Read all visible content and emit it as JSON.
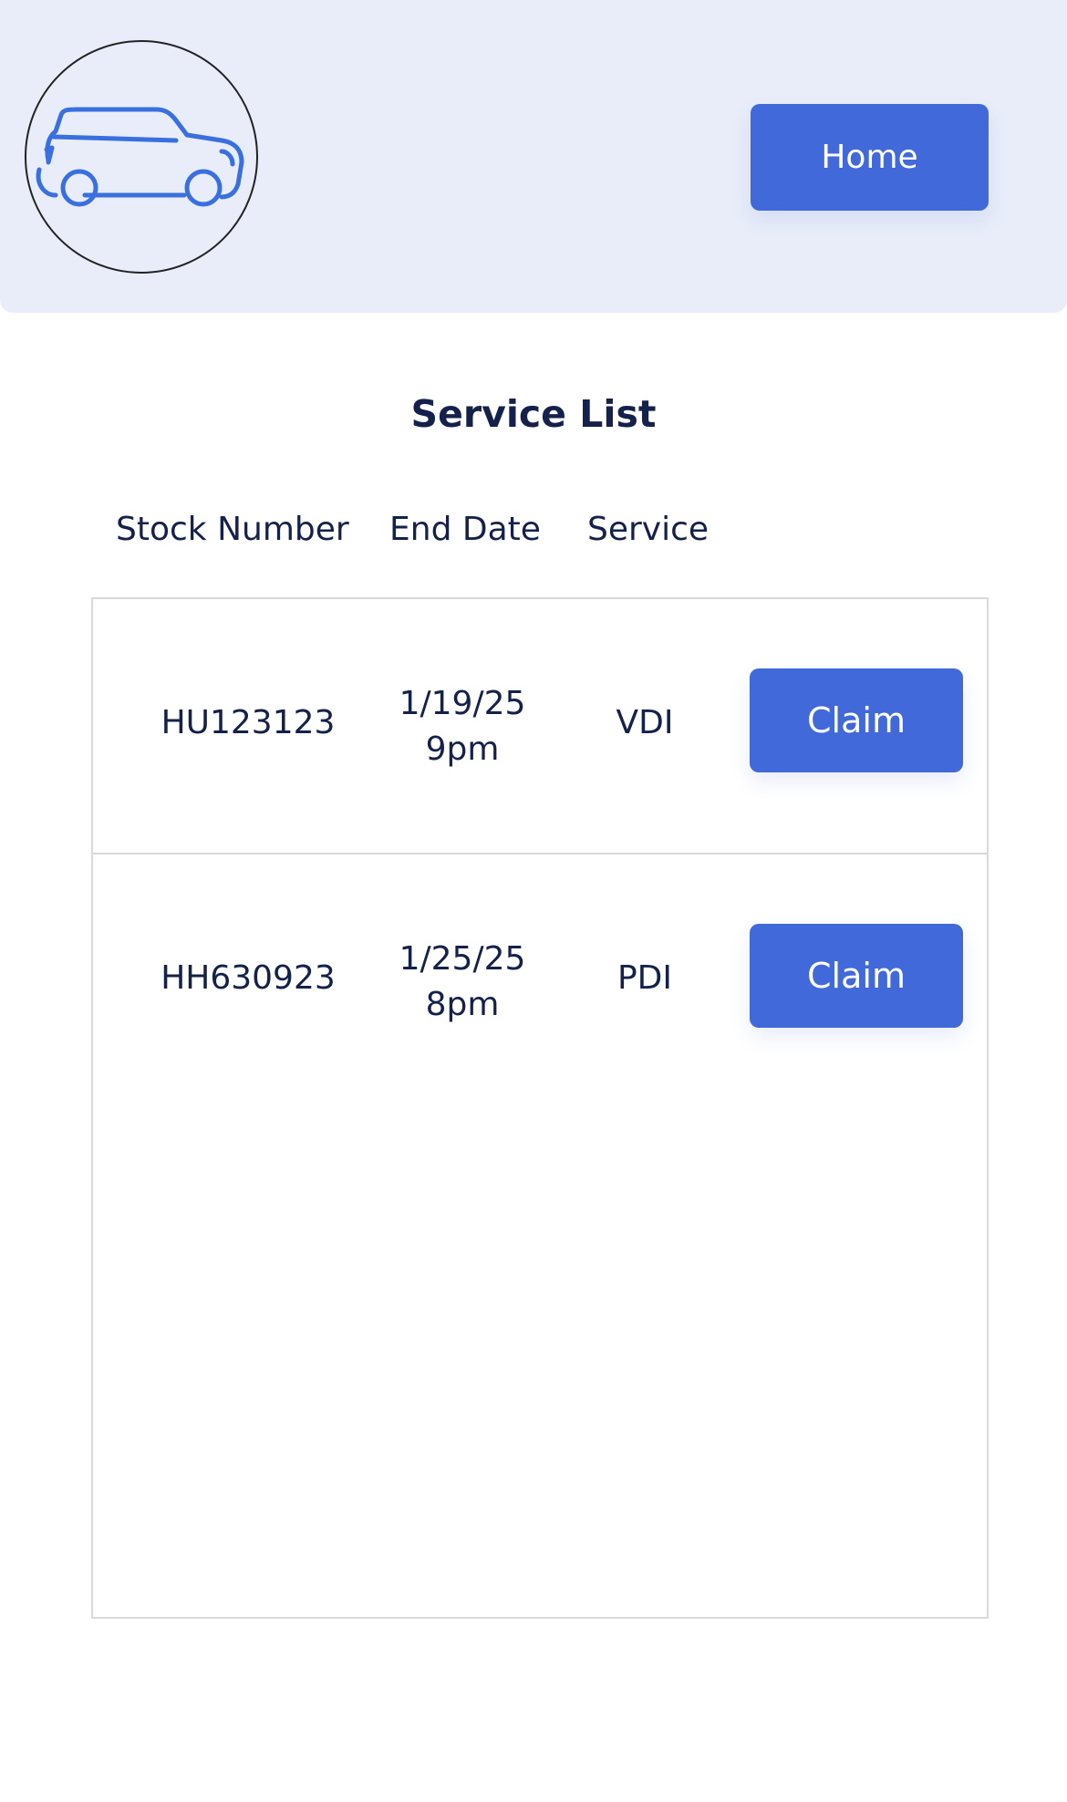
{
  "header": {
    "logo_icon": "car-icon",
    "home_label": "Home"
  },
  "title": "Service List",
  "columns": [
    "Stock Number",
    "End Date",
    "Service"
  ],
  "rows": [
    {
      "stock": "HU123123",
      "date_line1": "1/19/25",
      "date_line2": "9pm",
      "service": "VDI",
      "action": "Claim"
    },
    {
      "stock": "HH630923",
      "date_line1": "1/25/25",
      "date_line2": "8pm",
      "service": "PDI",
      "action": "Claim"
    }
  ],
  "colors": {
    "header_bg": "#e9edf9",
    "accent": "#4169d9",
    "text": "#14214a",
    "icon_stroke": "#3a6fe0"
  }
}
